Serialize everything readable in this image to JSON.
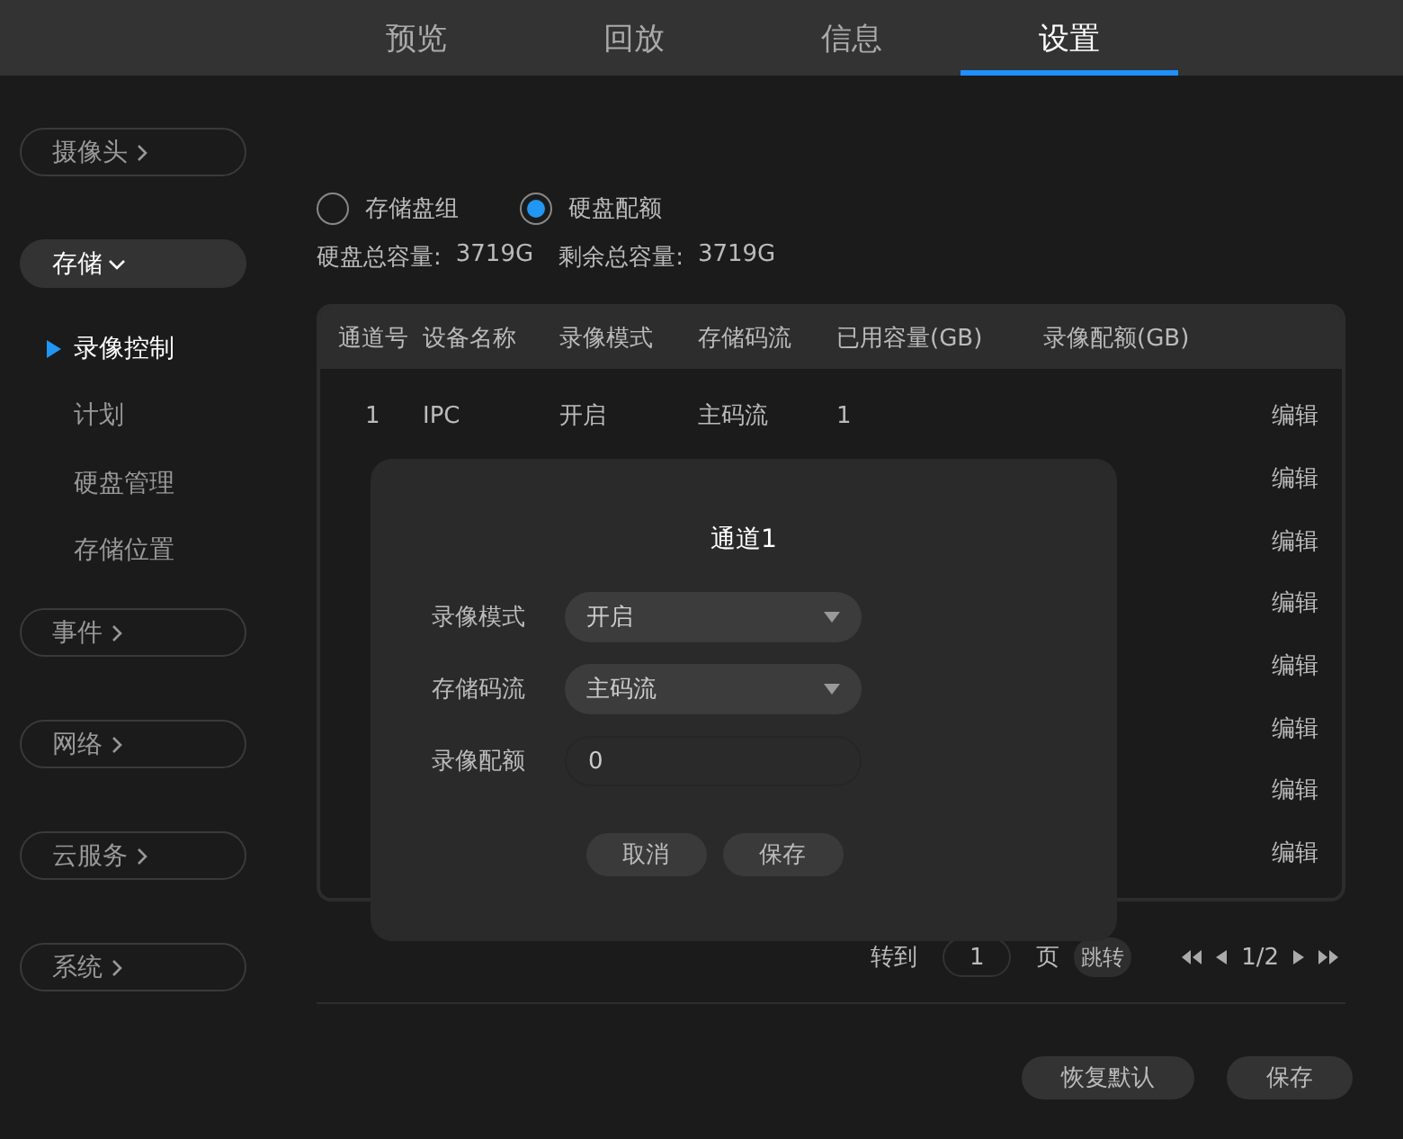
{
  "nav": {
    "tabs": [
      {
        "label": "预览",
        "selected": false
      },
      {
        "label": "回放",
        "selected": false
      },
      {
        "label": "信息",
        "selected": false
      },
      {
        "label": "设置",
        "selected": true
      }
    ]
  },
  "sidebar": {
    "groups": [
      {
        "label": "摄像头",
        "expanded": false
      },
      {
        "label": "存储",
        "expanded": true,
        "children": [
          {
            "label": "录像控制",
            "selected": true
          },
          {
            "label": "计划",
            "selected": false
          },
          {
            "label": "硬盘管理",
            "selected": false
          },
          {
            "label": "存储位置",
            "selected": false
          }
        ]
      },
      {
        "label": "事件",
        "expanded": false
      },
      {
        "label": "网络",
        "expanded": false
      },
      {
        "label": "云服务",
        "expanded": false
      },
      {
        "label": "系统",
        "expanded": false
      }
    ]
  },
  "mode_options": [
    {
      "label": "存储盘组",
      "selected": false
    },
    {
      "label": "硬盘配额",
      "selected": true
    }
  ],
  "capacity": [
    {
      "label": "硬盘总容量:",
      "value": "3719G"
    },
    {
      "label": "剩余总容量:",
      "value": "3719G"
    }
  ],
  "table": {
    "columns": [
      "通道号",
      "设备名称",
      "录像模式",
      "存储码流",
      "已用容量(GB)",
      "录像配额(GB)"
    ],
    "rows": [
      {
        "cells": [
          "1",
          "IPC",
          "开启",
          "主码流",
          "1",
          ""
        ],
        "action": "编辑"
      },
      {
        "action": "编辑"
      },
      {
        "action": "编辑"
      },
      {
        "action": "编辑"
      },
      {
        "action": "编辑"
      },
      {
        "action": "编辑"
      },
      {
        "action": "编辑"
      },
      {
        "action": "编辑"
      }
    ]
  },
  "pagination": {
    "goto_label": "转到",
    "page_value": "1",
    "page_label": "页",
    "jump_button": "跳转",
    "page_info": "1/2"
  },
  "footer_buttons": [
    "恢复默认",
    "保存"
  ],
  "dialog": {
    "title": "通道1",
    "fields": [
      {
        "kind": "select",
        "label": "录像模式",
        "value": "开启"
      },
      {
        "kind": "select",
        "label": "存储码流",
        "value": "主码流"
      },
      {
        "kind": "input",
        "label": "录像配额",
        "value": "0"
      }
    ],
    "buttons": [
      "取消",
      "保存"
    ]
  }
}
